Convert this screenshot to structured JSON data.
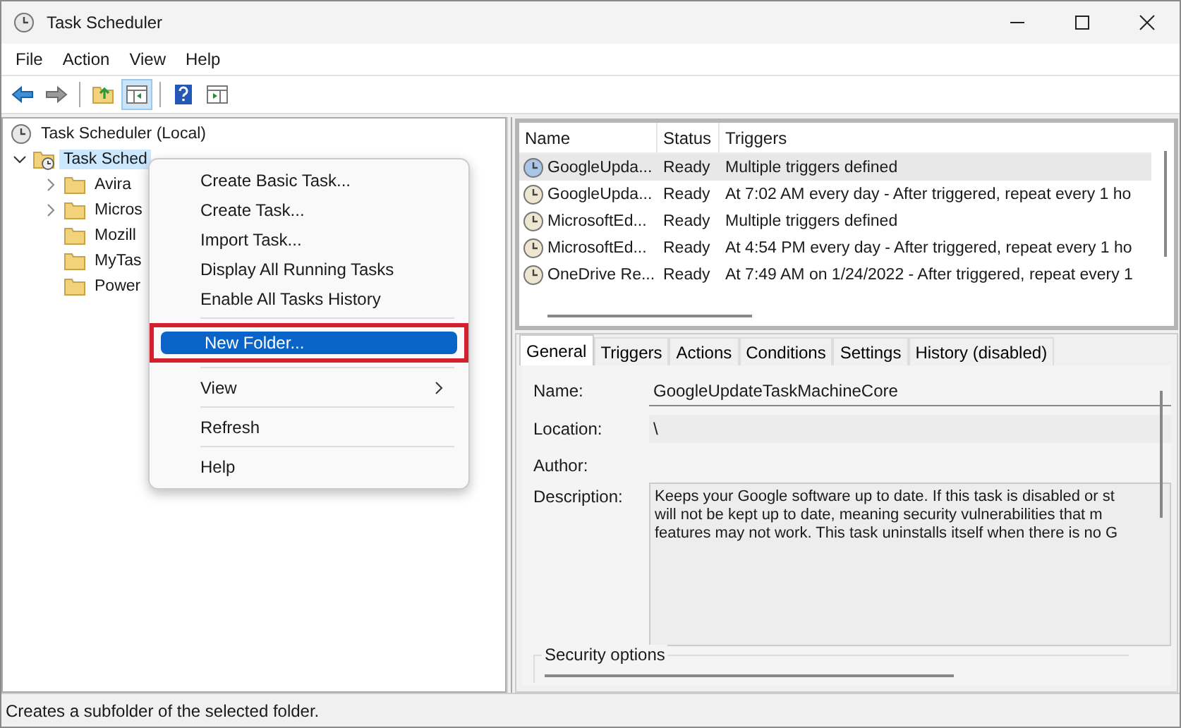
{
  "window": {
    "title": "Task Scheduler"
  },
  "menu_bar": [
    "File",
    "Action",
    "View",
    "Help"
  ],
  "toolbar": [
    {
      "kind": "back",
      "pressed": false
    },
    {
      "kind": "forward",
      "pressed": false
    },
    {
      "kind": "sep"
    },
    {
      "kind": "up",
      "pressed": false
    },
    {
      "kind": "pane",
      "pressed": true
    },
    {
      "kind": "sep"
    },
    {
      "kind": "help",
      "pressed": false
    },
    {
      "kind": "actionpane",
      "pressed": false
    }
  ],
  "tree": [
    {
      "label": "Task Scheduler (Local)",
      "children": [
        {
          "label": "Task Sched",
          "expanded": true,
          "selected": true,
          "children": [
            {
              "label": "Avira",
              "expandable": true,
              "selected": false
            },
            {
              "label": "Micros",
              "expandable": true,
              "selected": false
            },
            {
              "label": "Mozill",
              "expandable": false,
              "selected": false
            },
            {
              "label": "MyTas",
              "expandable": false,
              "selected": false
            },
            {
              "label": "Power",
              "expandable": false,
              "selected": false
            }
          ]
        }
      ]
    }
  ],
  "context_menu": [
    {
      "kind": "item",
      "label": "Create Basic Task...",
      "selected": false
    },
    {
      "kind": "item",
      "label": "Create Task...",
      "selected": false
    },
    {
      "kind": "item",
      "label": "Import Task...",
      "selected": false
    },
    {
      "kind": "item",
      "label": "Display All Running Tasks",
      "selected": false
    },
    {
      "kind": "item",
      "label": "Enable All Tasks History",
      "selected": false
    },
    {
      "kind": "separator"
    },
    {
      "kind": "item",
      "label": "New Folder...",
      "selected": true,
      "highlighted": true
    },
    {
      "kind": "separator"
    },
    {
      "kind": "submenu",
      "label": "View",
      "selected": false
    },
    {
      "kind": "separator"
    },
    {
      "kind": "item",
      "label": "Refresh",
      "selected": false
    },
    {
      "kind": "separator"
    },
    {
      "kind": "item",
      "label": "Help",
      "selected": false
    }
  ],
  "task_list": {
    "columns": [
      "Name",
      "Status",
      "Triggers"
    ],
    "rows": [
      {
        "name": "GoogleUpda...",
        "status": "Ready",
        "triggers": "Multiple triggers defined",
        "selected": true
      },
      {
        "name": "GoogleUpda...",
        "status": "Ready",
        "triggers": "At 7:02 AM every day - After triggered, repeat every 1 ho",
        "selected": false
      },
      {
        "name": "MicrosoftEd...",
        "status": "Ready",
        "triggers": "Multiple triggers defined",
        "selected": false
      },
      {
        "name": "MicrosoftEd...",
        "status": "Ready",
        "triggers": "At 4:54 PM every day - After triggered, repeat every 1 ho",
        "selected": false
      },
      {
        "name": "OneDrive Re...",
        "status": "Ready",
        "triggers": "At 7:49 AM on 1/24/2022 - After triggered, repeat every 1",
        "selected": false
      }
    ]
  },
  "detail_tabs": [
    {
      "label": "General",
      "selected": true
    },
    {
      "label": "Triggers",
      "selected": false
    },
    {
      "label": "Actions",
      "selected": false
    },
    {
      "label": "Conditions",
      "selected": false
    },
    {
      "label": "Settings",
      "selected": false
    },
    {
      "label": "History (disabled)",
      "selected": false
    }
  ],
  "general": {
    "fields": [
      {
        "kind": "field",
        "label": "Name:",
        "value": "GoogleUpdateTaskMachineCore"
      },
      {
        "kind": "readonly",
        "label": "Location:",
        "value": "\\"
      },
      {
        "kind": "plain",
        "label": "Author:"
      },
      {
        "kind": "textarea",
        "label": "Description:",
        "lines": [
          "Keeps your Google software up to date. If this task is disabled or st",
          "will not be kept up to date, meaning security vulnerabilities that m",
          "features may not work. This task uninstalls itself when there is no G"
        ]
      }
    ],
    "group_title": "Security options"
  },
  "status_bar": "Creates a subfolder of the selected folder."
}
